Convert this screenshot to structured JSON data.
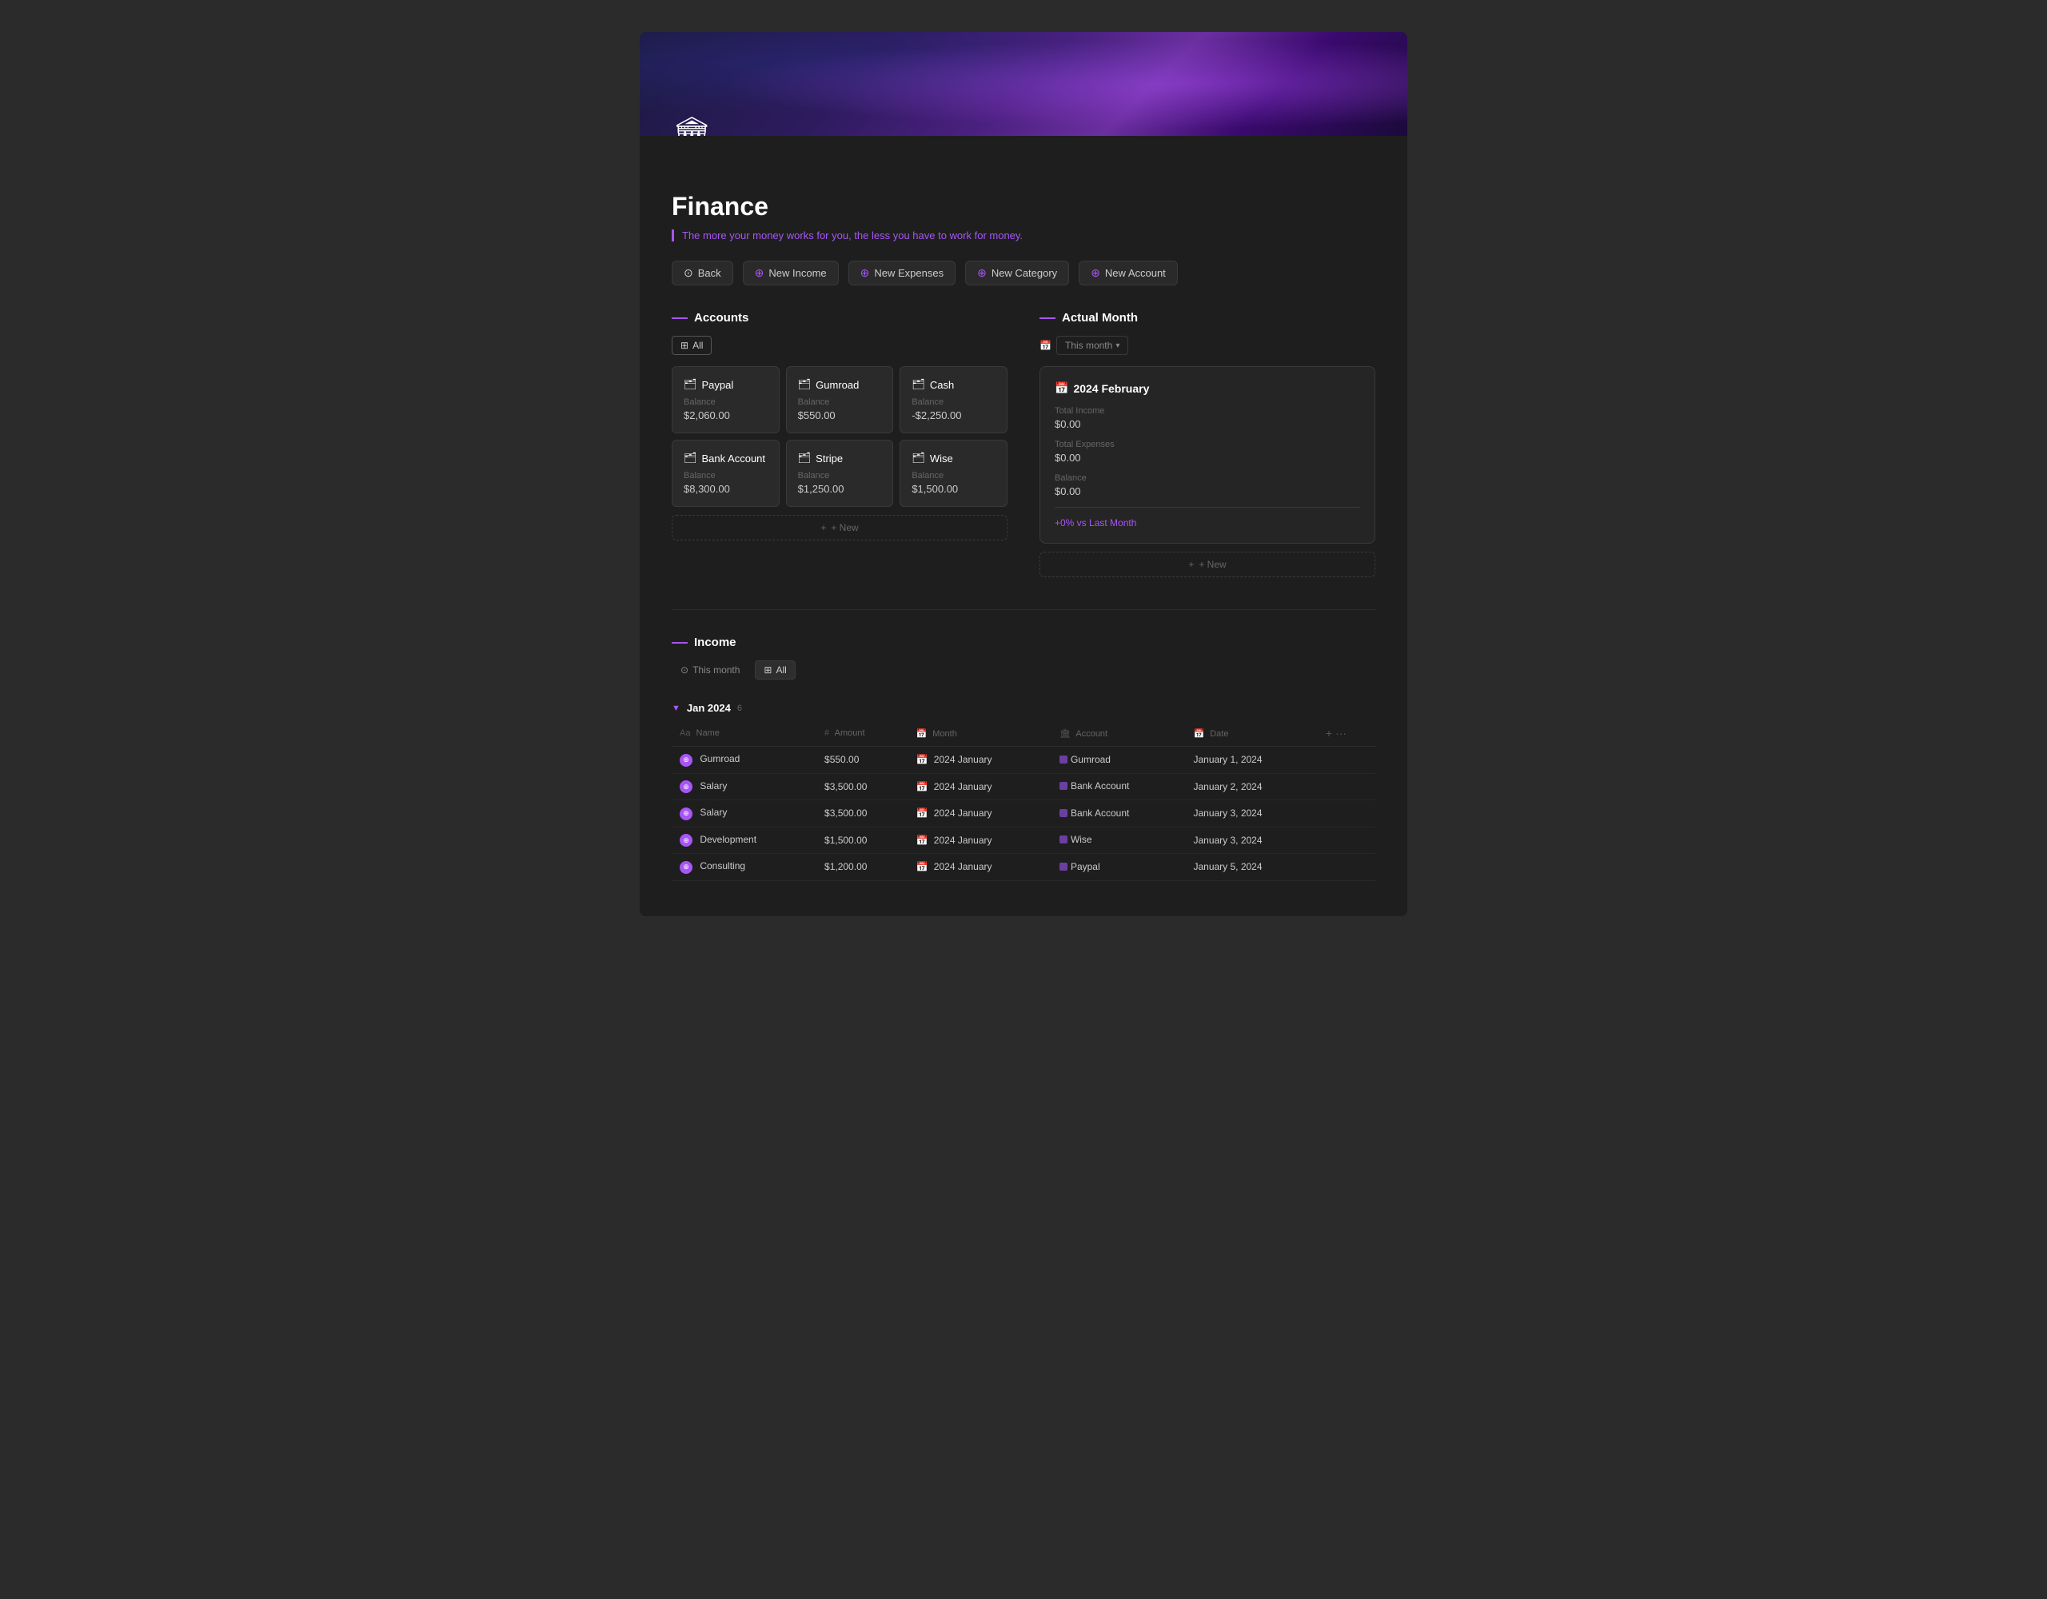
{
  "page": {
    "title": "Finance",
    "subtitle": "The more your money works for you, the less you have to work for money.",
    "icon": "🏛"
  },
  "toolbar": {
    "back_label": "Back",
    "new_income_label": "New Income",
    "new_expenses_label": "New Expenses",
    "new_category_label": "New Category",
    "new_account_label": "New Account"
  },
  "accounts_section": {
    "title": "Accounts",
    "view_all_label": "All",
    "add_new_label": "+ New",
    "accounts": [
      {
        "name": "Paypal",
        "balance_label": "Balance",
        "balance": "$2,060.00"
      },
      {
        "name": "Gumroad",
        "balance_label": "Balance",
        "balance": "$550.00"
      },
      {
        "name": "Cash",
        "balance_label": "Balance",
        "balance": "-$2,250.00"
      },
      {
        "name": "Bank Account",
        "balance_label": "Balance",
        "balance": "$8,300.00"
      },
      {
        "name": "Stripe",
        "balance_label": "Balance",
        "balance": "$1,250.00"
      },
      {
        "name": "Wise",
        "balance_label": "Balance",
        "balance": "$1,500.00"
      }
    ]
  },
  "actual_month_section": {
    "title": "Actual Month",
    "this_month_label": "This month",
    "card": {
      "period": "2024 February",
      "total_income_label": "Total Income",
      "total_income": "$0.00",
      "total_expenses_label": "Total Expenses",
      "total_expenses": "$0.00",
      "balance_label": "Balance",
      "balance": "$0.00",
      "change_label": "+0% vs Last Month"
    },
    "add_new_label": "+ New"
  },
  "income_section": {
    "title": "Income",
    "filter_this_month": "This month",
    "filter_all": "All",
    "group": {
      "label": "Jan 2024",
      "count": "6",
      "chevron": "▼"
    },
    "columns": [
      {
        "icon": "Aa",
        "label": "Name"
      },
      {
        "icon": "#",
        "label": "Amount"
      },
      {
        "icon": "📅",
        "label": "Month"
      },
      {
        "icon": "🏛",
        "label": "Account"
      },
      {
        "icon": "📅",
        "label": "Date"
      }
    ],
    "rows": [
      {
        "name": "Gumroad",
        "amount": "$550.00",
        "month": "2024 January",
        "account": "Gumroad",
        "date": "January 1, 2024"
      },
      {
        "name": "Salary",
        "amount": "$3,500.00",
        "month": "2024 January",
        "account": "Bank Account",
        "date": "January 2, 2024"
      },
      {
        "name": "Salary",
        "amount": "$3,500.00",
        "month": "2024 January",
        "account": "Bank Account",
        "date": "January 3, 2024"
      },
      {
        "name": "Development",
        "amount": "$1,500.00",
        "month": "2024 January",
        "account": "Wise",
        "date": "January 3, 2024"
      },
      {
        "name": "Consulting",
        "amount": "$1,200.00",
        "month": "2024 January",
        "account": "Paypal",
        "date": "January 5, 2024"
      }
    ]
  }
}
